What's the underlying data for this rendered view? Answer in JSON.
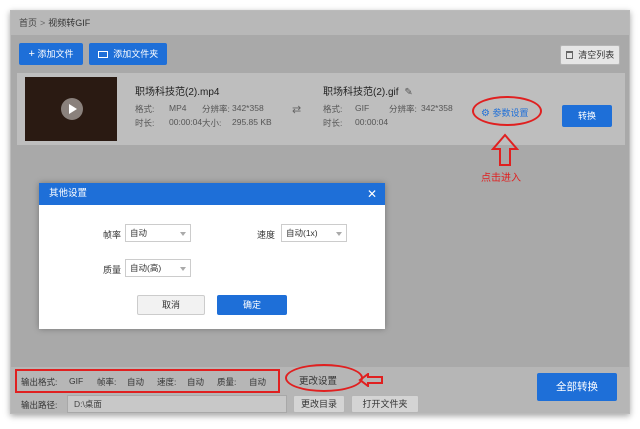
{
  "breadcrumb": {
    "home": "首页",
    "separator": ">",
    "current": "视频转GIF"
  },
  "toolbar": {
    "add_file": "添加文件",
    "add_folder": "添加文件夹",
    "clear_list": "清空列表"
  },
  "file": {
    "source": {
      "name": "职场科技范(2).mp4",
      "format_label": "格式:",
      "format": "MP4",
      "resolution_label": "分辨率:",
      "resolution": "342*358",
      "duration_label": "时长:",
      "duration": "00:00:04",
      "size_label": "大小:",
      "size": "295.85 KB"
    },
    "output": {
      "name": "职场科技范(2).gif",
      "format_label": "格式:",
      "format": "GIF",
      "resolution_label": "分辨率:",
      "resolution": "342*358",
      "duration_label": "时长:",
      "duration": "00:00:04"
    },
    "param_settings": "参数设置",
    "convert": "转换"
  },
  "annotation": {
    "click_enter": "点击进入"
  },
  "dialog": {
    "title": "其他设置",
    "framerate_label": "帧率",
    "framerate_value": "自动",
    "speed_label": "速度",
    "speed_value": "自动(1x)",
    "quality_label": "质量",
    "quality_value": "自动(高)",
    "cancel": "取消",
    "confirm": "确定"
  },
  "bottom": {
    "output_format_label": "输出格式:",
    "output_format_value": "GIF",
    "framerate_label": "帧率:",
    "framerate_value": "自动",
    "speed_label": "速度:",
    "speed_value": "自动",
    "quality_label": "质量:",
    "quality_value": "自动",
    "change_settings": "更改设置",
    "output_path_label": "输出路径:",
    "output_path_value": "D:\\桌面",
    "change_dir": "更改目录",
    "open_folder": "打开文件夹",
    "convert_all": "全部转换"
  },
  "colors": {
    "accent": "#1e6fd8",
    "annotation_red": "#e02020"
  }
}
